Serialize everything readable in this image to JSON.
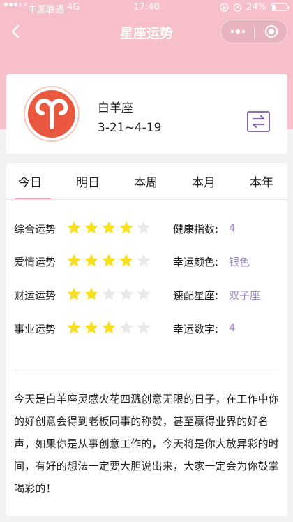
{
  "status_bar": {
    "carrier": "中国联通",
    "network": "4G",
    "time": "17:48",
    "battery": "24%"
  },
  "nav": {
    "title": "星座运势"
  },
  "sign": {
    "name": "白羊座",
    "date_range": "3-21~4-19",
    "logo_color": "#e9573f"
  },
  "tabs": [
    "今日",
    "明日",
    "本周",
    "本月",
    "本年"
  ],
  "active_tab_index": 0,
  "fortunes": [
    {
      "label": "综合运势",
      "stars": 4,
      "info_label": "健康指数:",
      "info_value": "4"
    },
    {
      "label": "爱情运势",
      "stars": 4,
      "info_label": "幸运颜色:",
      "info_value": "银色"
    },
    {
      "label": "财运运势",
      "stars": 2,
      "info_label": "速配星座:",
      "info_value": "双子座"
    },
    {
      "label": "事业运势",
      "stars": 3,
      "info_label": "幸运数字:",
      "info_value": "4"
    }
  ],
  "max_stars": 5,
  "description": "今天是白羊座灵感火花四溅创意无限的日子，在工作中你的好创意会得到老板同事的称赞，甚至赢得业界的好名声，如果你是从事创意工作的，今天将是你大放异彩的时间，有好的想法一定要大胆说出来，大家一定会为你鼓掌喝彩的！",
  "colors": {
    "header_pink": "#f6bfca",
    "accent_purple": "#8c6bb0",
    "value_purple": "#a08bc2",
    "star_on": "#f7e01f",
    "star_off": "#e9e9e9",
    "tab_underline": "#f2a3b5"
  }
}
